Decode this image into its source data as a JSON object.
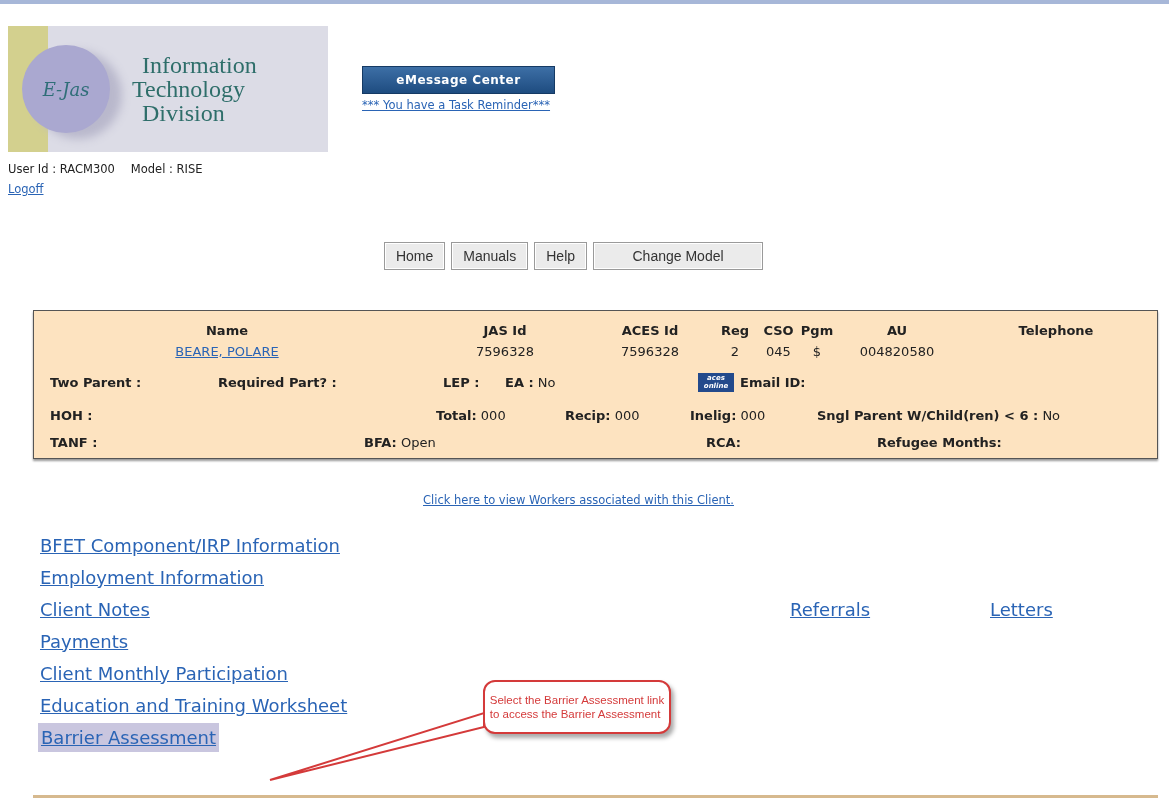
{
  "header": {
    "logo": {
      "badge": "E-Jas",
      "lines": [
        "Information",
        "Technology",
        "Division"
      ]
    },
    "message_center_button": "eMessage Center",
    "task_reminder": "*** You have a Task Reminder***",
    "user_id": "User Id : RACM300",
    "model": "Model : RISE",
    "logoff": "Logoff"
  },
  "nav_buttons": [
    "Home",
    "Manuals",
    "Help",
    "Change Model"
  ],
  "client_panel": {
    "columns": [
      {
        "label": "Name",
        "value": "BEARE, POLARE",
        "kind": "link"
      },
      {
        "label": "JAS Id",
        "value": "7596328",
        "kind": "text"
      },
      {
        "label": "ACES Id",
        "value": "7596328",
        "kind": "text"
      },
      {
        "label": "Reg",
        "value": "2",
        "kind": "text"
      },
      {
        "label": "CSO",
        "value": "045",
        "kind": "text"
      },
      {
        "label": "Pgm",
        "value": "$",
        "kind": "text"
      },
      {
        "label": "AU",
        "value": "004820580",
        "kind": "text"
      },
      {
        "label": "Telephone"
      }
    ],
    "detail_rows": [
      [
        {
          "label": "Two Parent :",
          "kind": "field"
        },
        {
          "label": "Required Part? :",
          "kind": "field"
        },
        {
          "label": "LEP :",
          "kind": "field"
        },
        {
          "label": "EA :",
          "value": "No",
          "kind": "field"
        },
        {
          "label": "aces online",
          "kind": "logo"
        },
        {
          "label": "Email ID:",
          "kind": "field"
        }
      ],
      [
        {
          "label": "HOH :",
          "kind": "field"
        },
        {
          "label": "Total:",
          "value": "000",
          "kind": "field"
        },
        {
          "label": "Recip:",
          "value": "000",
          "kind": "field"
        },
        {
          "label": "Inelig:",
          "value": "000",
          "kind": "field"
        },
        {
          "label": "Sngl Parent W/Child(ren) < 6 :",
          "value": "No",
          "kind": "field"
        }
      ],
      [
        {
          "label": "TANF :",
          "kind": "field"
        },
        {
          "label": "BFA:",
          "value": "Open",
          "kind": "field"
        },
        {
          "label": "RCA:",
          "kind": "field"
        },
        {
          "label": "Refugee Months:",
          "kind": "field"
        }
      ]
    ]
  },
  "workers_link": "Click here to view Workers associated with this Client.",
  "links": [
    {
      "label": "BFET Component/IRP Information",
      "highlighted": false
    },
    {
      "label": "Employment Information",
      "highlighted": false
    },
    {
      "label": "Client Notes",
      "highlighted": false
    },
    {
      "label": "Payments",
      "highlighted": false
    },
    {
      "label": "Client Monthly Participation",
      "highlighted": false
    },
    {
      "label": "Education and Training Worksheet",
      "highlighted": false
    },
    {
      "label": "Barrier Assessment",
      "highlighted": true
    }
  ],
  "side_links": [
    "Referrals",
    "Letters"
  ],
  "callout": {
    "lines": [
      "Select the Barrier Assessment link",
      "to access the Barrier Assessment"
    ]
  }
}
